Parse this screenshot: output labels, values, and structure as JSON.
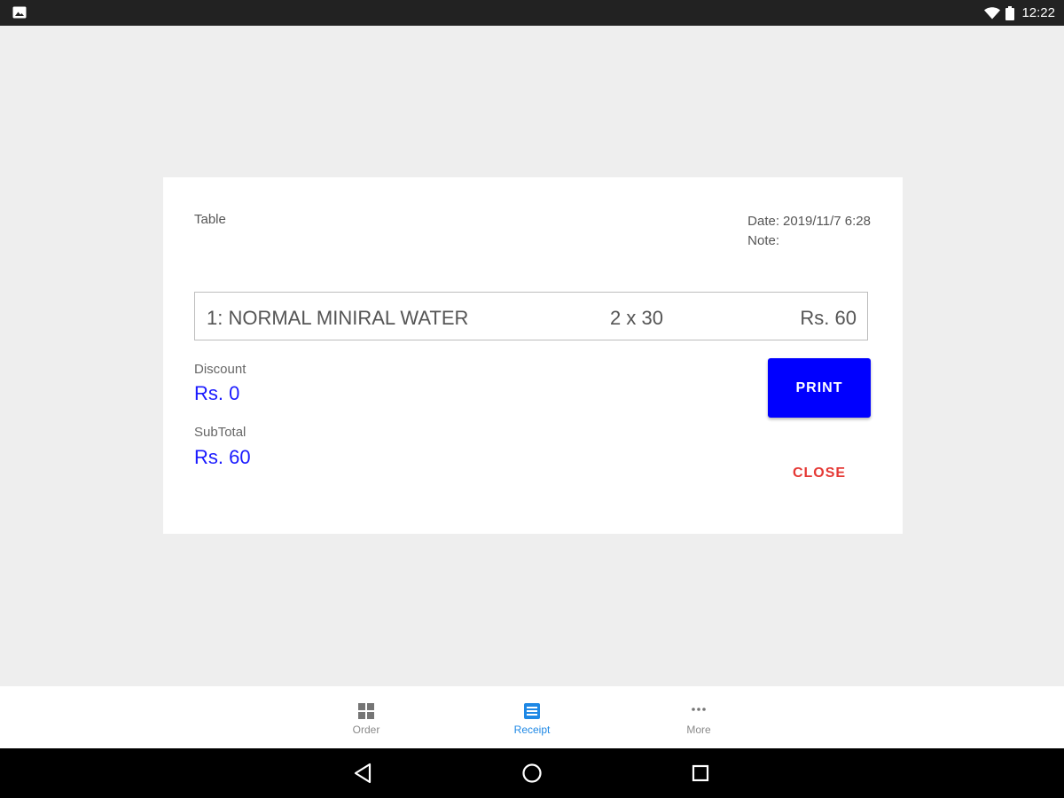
{
  "status_bar": {
    "time": "12:22",
    "icons": [
      "image-notification-icon",
      "wifi-icon",
      "battery-icon"
    ]
  },
  "receipt": {
    "table_label": "Table",
    "date_label": "Date:",
    "date_value": "2019/11/7 6:28",
    "note_label": "Note:",
    "note_value": "",
    "items": [
      {
        "name": "1: NORMAL MINIRAL WATER",
        "qty": "2 x 30",
        "price": "Rs. 60"
      }
    ],
    "discount_label": "Discount",
    "discount_value": "Rs. 0",
    "subtotal_label": "SubTotal",
    "subtotal_value": "Rs. 60",
    "print_label": "PRINT",
    "close_label": "CLOSE"
  },
  "bottom_nav": {
    "items": [
      {
        "label": "Order",
        "icon": "grid-icon",
        "active": false
      },
      {
        "label": "Receipt",
        "icon": "receipt-icon",
        "active": true
      },
      {
        "label": "More",
        "icon": "more-dots-icon",
        "active": false
      }
    ]
  },
  "android_nav": [
    "back-icon",
    "home-icon",
    "recents-icon"
  ],
  "colors": {
    "accent_blue": "#0000ff",
    "value_blue": "#1a1aff",
    "close_red": "#e53935",
    "active_tab": "#1e88e5"
  }
}
